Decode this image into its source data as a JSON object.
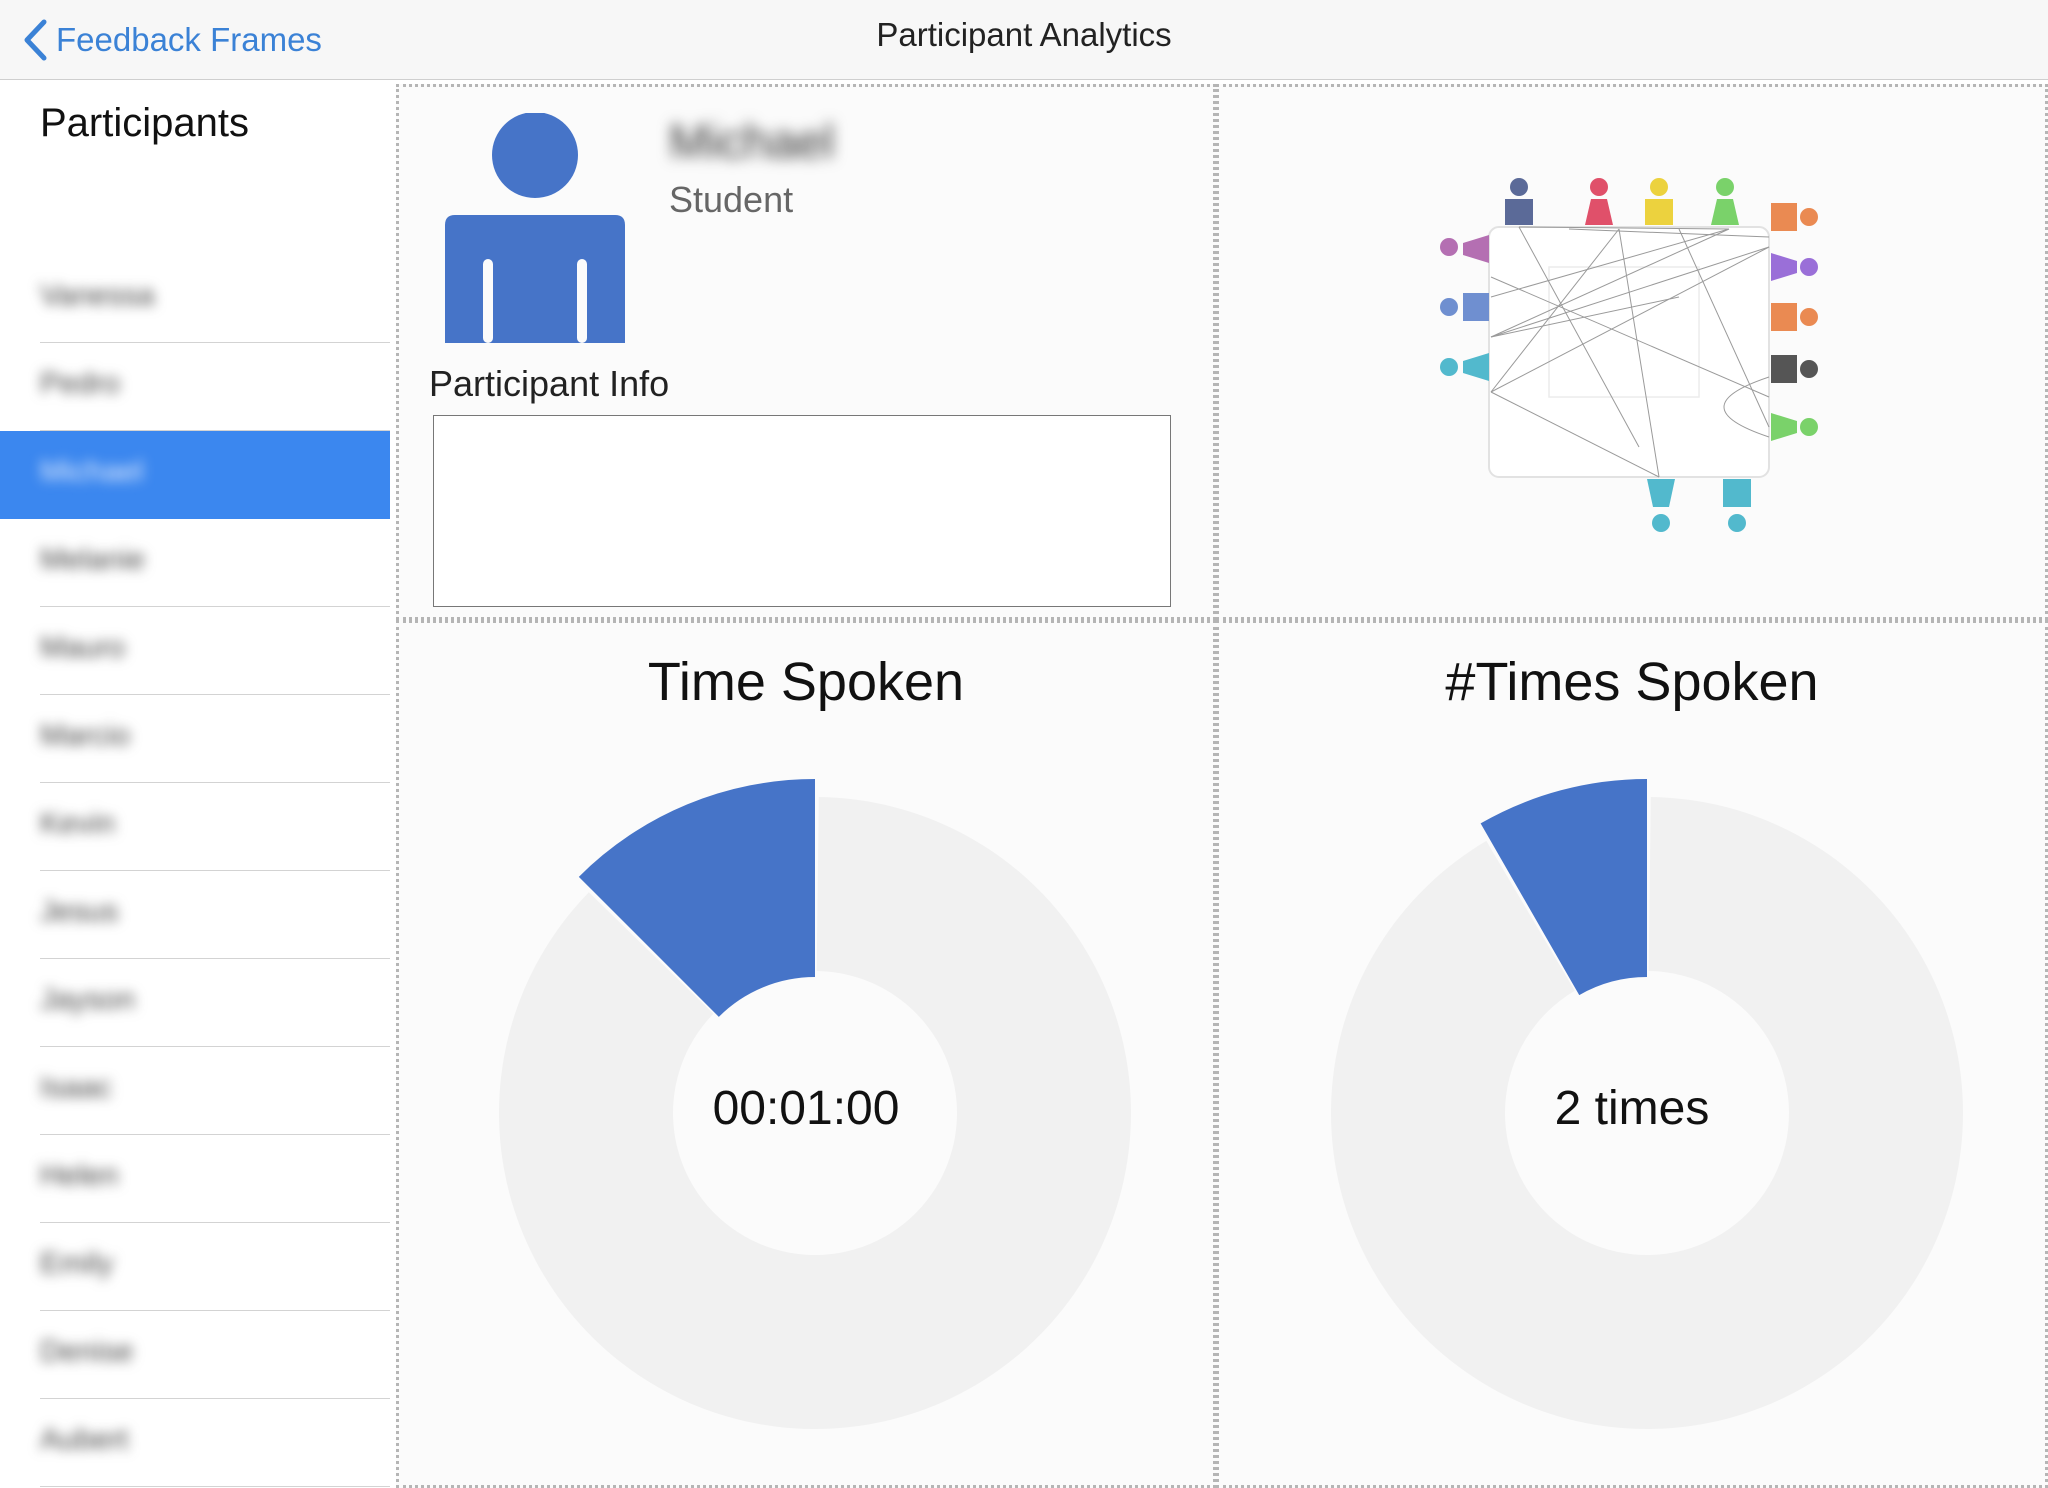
{
  "nav": {
    "back_label": "Feedback Frames",
    "title": "Participant Analytics"
  },
  "sidebar": {
    "heading": "Participants",
    "selected_index": 2,
    "items": [
      {
        "label": "Vanessa"
      },
      {
        "label": "Pedro"
      },
      {
        "label": "Michael"
      },
      {
        "label": "Melanie"
      },
      {
        "label": "Mauro"
      },
      {
        "label": "Marcio"
      },
      {
        "label": "Kevin"
      },
      {
        "label": "Jesus"
      },
      {
        "label": "Jayson"
      },
      {
        "label": "Isaac"
      },
      {
        "label": "Helen"
      },
      {
        "label": "Emily"
      },
      {
        "label": "Denise"
      },
      {
        "label": "Aubert"
      }
    ]
  },
  "participant": {
    "name": "Michael",
    "role": "Student",
    "info_label": "Participant Info",
    "info_text": ""
  },
  "time_spoken": {
    "title": "Time Spoken",
    "center_text": "00:01:00",
    "fraction": 0.125,
    "accent_color": "#4674c8",
    "track_color": "#f1f1f1"
  },
  "times_spoken": {
    "title": "#Times Spoken",
    "center_text": "2 times",
    "fraction": 0.083,
    "accent_color": "#4674c8",
    "track_color": "#f1f1f1"
  },
  "colors": {
    "accent": "#3b87ef",
    "link": "#3b82d6",
    "avatar": "#4674c8"
  },
  "icons": {
    "back": "chevron-left-icon",
    "avatar": "person-icon",
    "network": "seating-network-icon"
  }
}
